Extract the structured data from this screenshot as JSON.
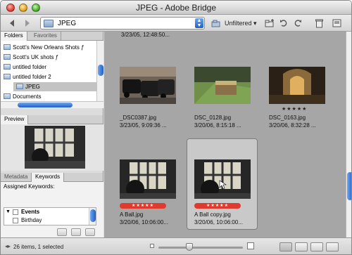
{
  "window": {
    "title": "JPEG - Adobe Bridge"
  },
  "toolbar": {
    "path": "JPEG",
    "filter": "Unfiltered",
    "icons": [
      "back-arrow-icon",
      "forward-arrow-icon",
      "folder-icon",
      "new-folder-icon",
      "rotate-left-icon",
      "rotate-right-icon",
      "trash-icon",
      "compact-mode-icon"
    ]
  },
  "left_panel": {
    "tabs": {
      "folders": "Folders",
      "favorites": "Favorites",
      "metadata": "Metadata",
      "keywords": "Keywords"
    },
    "folders": [
      {
        "label": "Scott's New Orleans Shots ƒ"
      },
      {
        "label": "Scott's UK shots ƒ"
      },
      {
        "label": "untitled folder"
      },
      {
        "label": "untitled folder 2"
      },
      {
        "label": "JPEG"
      },
      {
        "label": "Documents"
      }
    ],
    "preview_title": "Preview",
    "assigned_keywords_label": "Assigned Keywords:",
    "keywords": [
      {
        "label": "Events"
      },
      {
        "label": "Birthday"
      }
    ]
  },
  "content": {
    "top_row_partial_caption": "3/23/05, 12:48:50...",
    "items": [
      {
        "filename": "_DSC0387.jpg",
        "date": "3/23/05, 9:09:36 ...",
        "rating": 0,
        "rating_text": ""
      },
      {
        "filename": "DSC_0128.jpg",
        "date": "3/20/06, 8:15:18 ...",
        "rating": 0,
        "rating_text": ""
      },
      {
        "filename": "DSC_0163.jpg",
        "date": "3/20/06, 8:32:28 ...",
        "rating": 5,
        "rating_text": "★★★★★"
      },
      {
        "filename": "A Ball.jpg",
        "date": "3/20/06, 10:06:00...",
        "rating": 5,
        "rating_text": "★★★★★"
      },
      {
        "filename": "A Ball copy.jpg",
        "date": "3/20/06, 10:06:00...",
        "rating": 5,
        "rating_text": "★★★★★"
      }
    ],
    "label_color": "#e03a2f"
  },
  "status": {
    "text": "26 items, 1 selected"
  },
  "colors": {
    "accent": "#1f5fc8",
    "panel": "#dcdcdc",
    "content_bg": "#a6a6a6"
  }
}
